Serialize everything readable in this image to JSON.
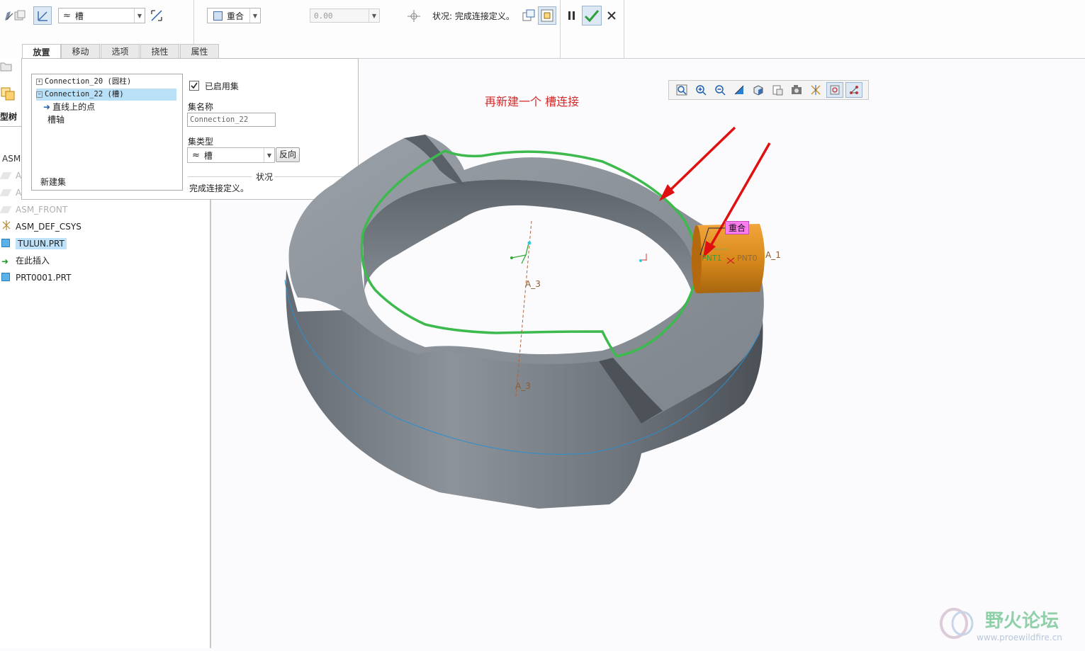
{
  "ribbon": {
    "connection_type_combo": "槽",
    "constraint_combo": "重合",
    "offset_value": "0.00",
    "status_label": "状况: 完成连接定义。"
  },
  "tabs": [
    {
      "label": "放置",
      "active": true
    },
    {
      "label": "移动"
    },
    {
      "label": "选项"
    },
    {
      "label": "挠性"
    },
    {
      "label": "属性"
    }
  ],
  "placement_panel": {
    "sets": [
      {
        "label": "Connection_20 (圆柱)",
        "expander": "+"
      },
      {
        "label": "Connection_22 (槽)",
        "expander": "−",
        "selected": true
      },
      {
        "label": "直线上的点"
      },
      {
        "label": "槽轴"
      }
    ],
    "new_set": "新建集",
    "enable_set_label": "已启用集",
    "set_name_label": "集名称",
    "set_name_value": "Connection_22",
    "set_type_label": "集类型",
    "set_type_value": "槽",
    "flip_button": "反向",
    "status_title": "状况",
    "status_text": "完成连接定义。"
  },
  "model_tree": {
    "title": "型树",
    "items": [
      {
        "label": "ASM",
        "dim": false
      },
      {
        "label": "A",
        "dim": true
      },
      {
        "label": "A",
        "dim": true
      },
      {
        "label": "ASM_FRONT",
        "dim": true
      },
      {
        "label": "ASM_DEF_CSYS",
        "dim": false
      },
      {
        "label": "TULUN.PRT",
        "dim": false,
        "highlighted": true
      },
      {
        "label": "在此插入",
        "dim": false
      },
      {
        "label": "PRT0001.PRT",
        "dim": false
      }
    ]
  },
  "viewport": {
    "annotation": "再新建一个  槽连接",
    "constraint_tag": "重合",
    "labels": {
      "pnt1": "PNT1",
      "pnt0": "PNT0",
      "a1": "A_1",
      "a3_top": "A_3",
      "a3_bottom": "A_3"
    }
  },
  "watermark": {
    "name": "野火论坛",
    "url": "www.proewildfire.cn"
  },
  "colors": {
    "part_gray": "#8a9097",
    "curve_green": "#3dba4e",
    "arrow_red": "#e01010",
    "pin_orange": "#d98a1c",
    "annotation_red": "#d42a2a",
    "tag_magenta": "#ff7cf0"
  }
}
